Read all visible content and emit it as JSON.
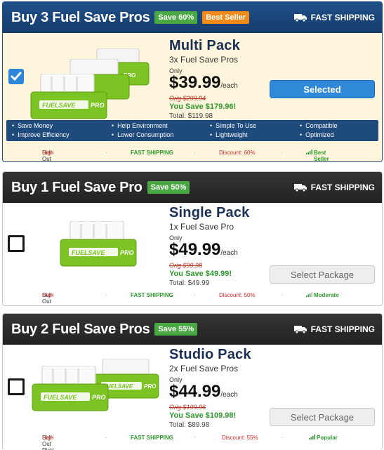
{
  "ship_label": "FAST SHIPPING",
  "packages": [
    {
      "title": "Buy 3 Fuel Save Pros",
      "badges": [
        {
          "text": "Save 60%",
          "color": "#49a843"
        },
        {
          "text": "Best Seller",
          "color": "#f08a1a"
        }
      ],
      "name": "Multi Pack",
      "sub": "3x Fuel Save Pros",
      "only": "Only",
      "price": "$39.99",
      "each": "/each",
      "orig": "Orig $299.94",
      "save": "You Save $179.96!",
      "total": "Total: $119.98",
      "button": "Selected",
      "checked": true,
      "device_label": "FUELSAVE PRO",
      "features": [
        "Save Money",
        "Help Environment",
        "Simple To Use",
        "Compatible",
        "Improve Efficiency",
        "Lower Consumption",
        "Lightweight",
        "Optimized"
      ],
      "risk_label": "Sell-Out Risk:",
      "risk": "High",
      "shipping": "FAST SHIPPING",
      "discount": "Discount: 60%",
      "popularity": "Best Seller"
    },
    {
      "title": "Buy 1 Fuel Save Pro",
      "badges": [
        {
          "text": "Save 50%",
          "color": "#49a843"
        }
      ],
      "name": "Single Pack",
      "sub": "1x Fuel Save Pro",
      "only": "Only",
      "price": "$49.99",
      "each": "/each",
      "orig": "Orig $99.98",
      "save": "You Save $49.99!",
      "total": "Total: $49.99",
      "button": "Select Package",
      "checked": false,
      "device_label": "FUELSAVE PRO",
      "risk_label": "Sell-Out Risk:",
      "risk": "High",
      "shipping": "FAST SHIPPING",
      "discount": "Discount: 50%",
      "popularity": "Moderate"
    },
    {
      "title": "Buy 2 Fuel Save Pros",
      "badges": [
        {
          "text": "Save 55%",
          "color": "#49a843"
        }
      ],
      "name": "Studio Pack",
      "sub": "2x Fuel Save Pros",
      "only": "Only",
      "price": "$44.99",
      "each": "/each",
      "orig": "Orig $199.96",
      "save": "You Save $109.98!",
      "total": "Total: $89.98",
      "button": "Select Package",
      "checked": false,
      "device_label": "FUELSAVE PRO",
      "risk_label": "Sell-Out Risk:",
      "risk": "High",
      "shipping": "FAST SHIPPING",
      "discount": "Discount: 55%",
      "popularity": "Popular"
    }
  ],
  "colors": {
    "header_selected": "#1e4f88",
    "header_default": "#2b2b2b",
    "accent_blue": "#2f88d8",
    "green": "#49a843",
    "orange": "#f08a1a",
    "red": "#d52b2b"
  }
}
